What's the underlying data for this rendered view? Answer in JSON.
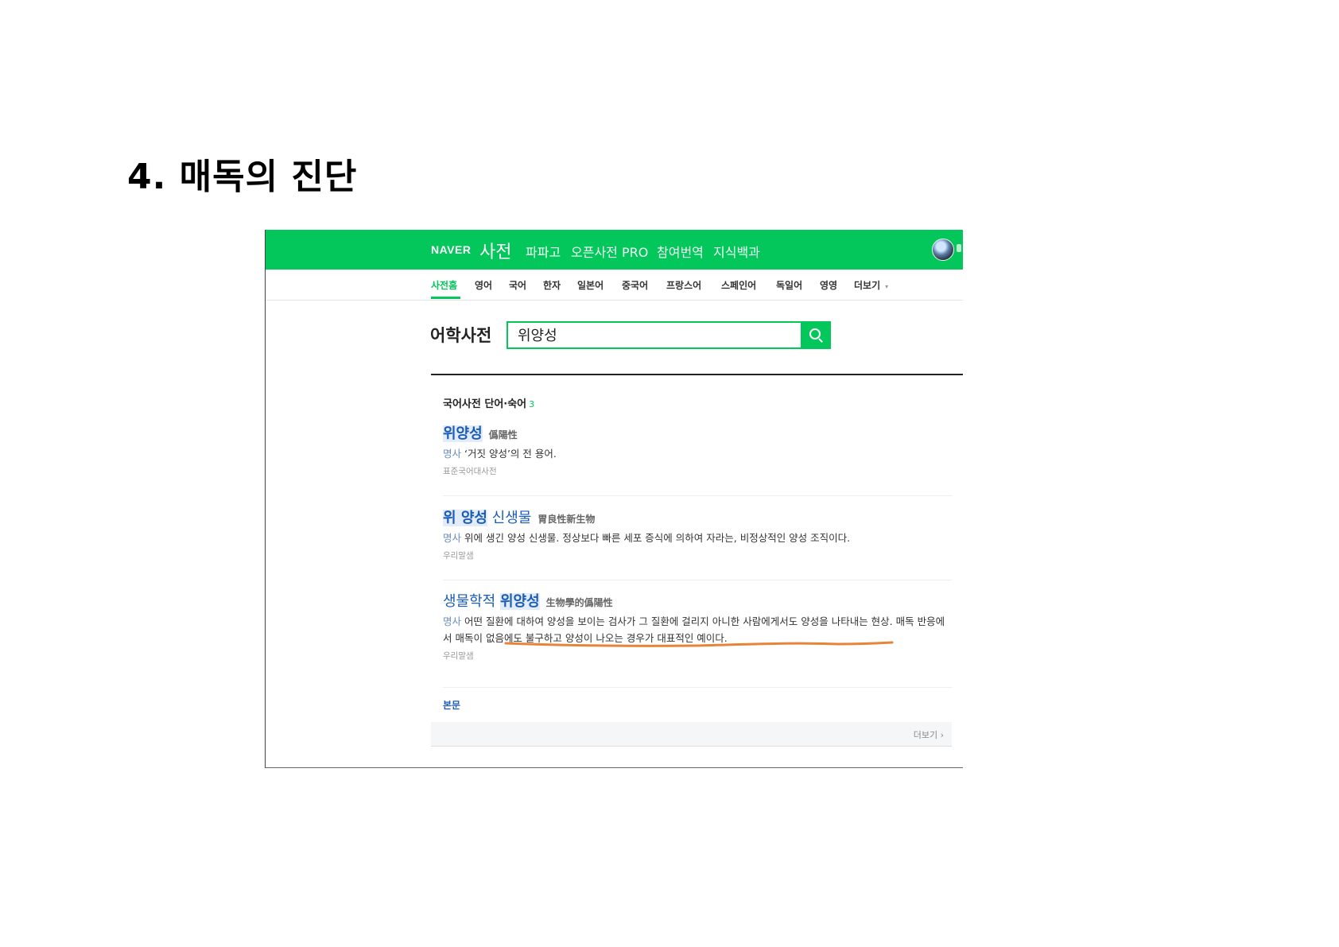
{
  "slide": {
    "title": "4. 매독의 진단"
  },
  "header": {
    "logo": "NAVER",
    "service": "사전",
    "menu": [
      "파파고",
      "오픈사전 PRO",
      "참여번역",
      "지식백과"
    ]
  },
  "tabs": [
    "사전홈",
    "영어",
    "국어",
    "한자",
    "일본어",
    "중국어",
    "프랑스어",
    "스페인어",
    "독일어",
    "영영",
    "더보기"
  ],
  "search": {
    "label": "어학사전",
    "value": "위양성"
  },
  "results": {
    "section_title": "국어사전 단어·숙어",
    "count": "3",
    "entries": [
      {
        "headword": "위양성",
        "hanja": "僞陽性",
        "pos": "명사",
        "definition": "‘거짓 양성’의 전 용어.",
        "source": "표준국어대사전"
      },
      {
        "headword_parts": [
          "위 양성",
          " 신생물"
        ],
        "hanja": "胃良性新生物",
        "pos": "명사",
        "definition": "위에 생긴 양성 신생물. 정상보다 빠른 세포 증식에 의하여 자라는, 비정상적인 양성 조직이다.",
        "source": "우리말샘"
      },
      {
        "headword_parts": [
          "생물학적 ",
          "위양성"
        ],
        "hanja": "生物學的僞陽性",
        "pos": "명사",
        "definition": "어떤 질환에 대하여 양성을 보이는 검사가 그 질환에 걸리지 아니한 사람에게서도 양성을 나타내는 현상. 매독 반응에서 매독이 없음에도 불구하고 양성이 나오는 경우가 대표적인 예이다.",
        "source": "우리말샘"
      }
    ],
    "body_title": "본문",
    "more_label": "더보기 ›"
  },
  "colors": {
    "naver_green": "#03c75a",
    "link_blue": "#1b5db6",
    "annotation_orange": "#e8843a"
  },
  "icons": {
    "search": "search-icon",
    "profile": "avatar"
  }
}
